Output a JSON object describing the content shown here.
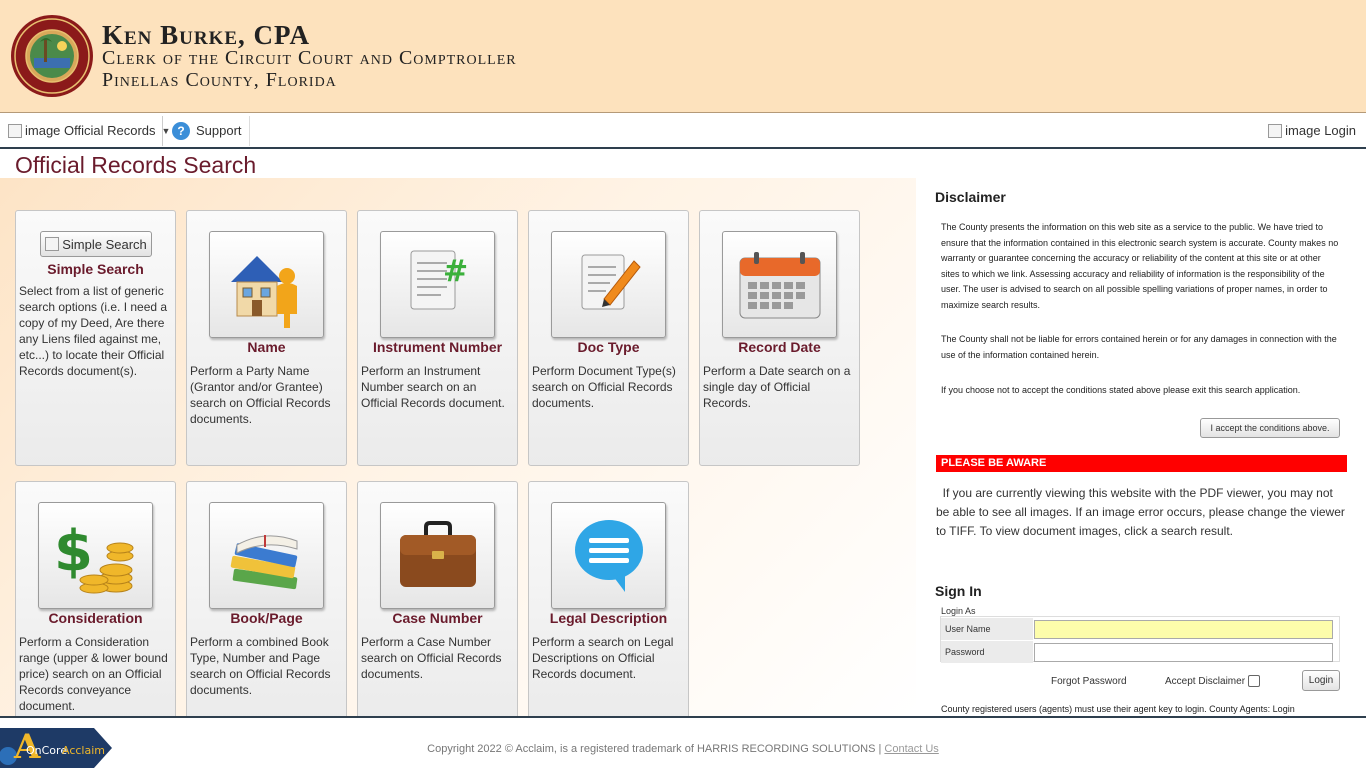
{
  "header": {
    "clerk_name": "Ken Burke, CPA",
    "title": "Clerk of the Circuit Court and Comptroller",
    "county": "Pinellas County, Florida"
  },
  "nav": {
    "official_records": "image Official Records",
    "support": "Support",
    "login": "image Login"
  },
  "page_title": "Official Records Search",
  "cards": {
    "simple": {
      "button": "Simple Search",
      "title": "Simple Search",
      "desc": "Select from a list of generic search options (i.e. I need a copy of my Deed, Are there any Liens filed against me, etc...) to locate their Official Records document(s)."
    },
    "name": {
      "title": "Name",
      "desc": "Perform a Party Name (Grantor and/or Grantee) search on Official Records documents."
    },
    "instrument": {
      "title": "Instrument Number",
      "desc": "Perform an Instrument Number search on an Official Records document."
    },
    "doctype": {
      "title": "Doc Type",
      "desc": "Perform Document Type(s) search on Official Records documents."
    },
    "recorddate": {
      "title": "Record Date",
      "desc": "Perform a Date search on a single day of Official Records."
    },
    "consideration": {
      "title": "Consideration",
      "desc": "Perform a Consideration range (upper & lower bound price) search on an Official Records conveyance document."
    },
    "bookpage": {
      "title": "Book/Page",
      "desc": "Perform a combined Book Type, Number and Page search on Official Records documents."
    },
    "casenumber": {
      "title": "Case Number",
      "desc": "Perform a Case Number search on Official Records documents."
    },
    "legal": {
      "title": "Legal Description",
      "desc": "Perform a search on Legal Descriptions on Official Records document."
    }
  },
  "disclaimer": {
    "title": "Disclaimer",
    "p1": "The County presents the information on this web site as a service to the public. We have tried to ensure that the information contained in this electronic search system is accurate. County makes no warranty or guarantee concerning the accuracy or reliability of the content at this site or at other sites to which we link. Assessing accuracy and reliability of information is the responsibility of the user. The user is advised to search on all possible spelling variations of proper names, in order to maximize search results.",
    "p2": "The County shall not be liable for errors contained herein or for any damages in connection with the use of the information contained herein.",
    "p3": "If you choose not to accept the conditions stated above please exit this search application.",
    "accept_button": "I accept the conditions above."
  },
  "aware": {
    "label": "PLEASE BE AWARE",
    "text": "If you are currently viewing this website with the PDF viewer, you may not be able to see all images. If an image error occurs, please change the viewer to TIFF. To view document images, click a search result."
  },
  "signin": {
    "title": "Sign In",
    "login_as": "Login As",
    "username_label": "User Name",
    "password_label": "Password",
    "username_value": "",
    "password_value": "",
    "forgot": "Forgot Password",
    "accept_disclaimer": "Accept Disclaimer",
    "login_button": "Login",
    "agents_note": "County registered users (agents) must use their agent key to login. County Agents: Login"
  },
  "footer": {
    "copyright": "Copyright 2022 © Acclaim, is a registered trademark of HARRIS RECORDING SOLUTIONS | ",
    "contact": "Contact Us",
    "logo_text_1": "OnCore",
    "logo_text_2": "Acclaim"
  },
  "colors": {
    "header_bg": "#fde2bd",
    "title_maroon": "#6a1b2c",
    "aware_red": "#ff0000",
    "nav_border": "#2e3f4e"
  }
}
